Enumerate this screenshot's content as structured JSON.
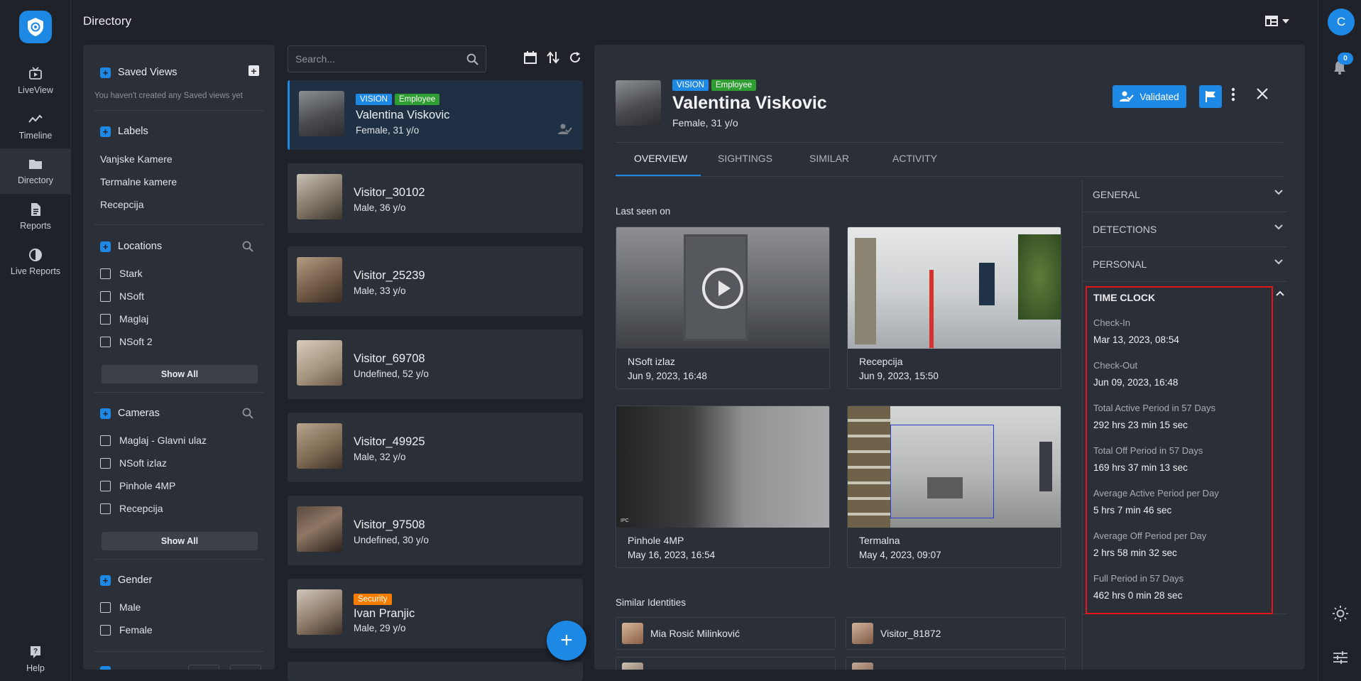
{
  "nav": {
    "items": [
      {
        "label": "LiveView",
        "icon": "liveview-icon"
      },
      {
        "label": "Timeline",
        "icon": "timeline-icon"
      },
      {
        "label": "Directory",
        "icon": "folder-icon"
      },
      {
        "label": "Reports",
        "icon": "reports-icon"
      },
      {
        "label": "Live Reports",
        "icon": "live-reports-icon"
      }
    ],
    "help": "Help"
  },
  "page": {
    "title": "Directory"
  },
  "user": {
    "initial": "C",
    "notifications": "0"
  },
  "filters": {
    "saved_views": {
      "title": "Saved Views",
      "note": "You haven't created any Saved views yet"
    },
    "labels": {
      "title": "Labels",
      "items": [
        "Vanjske Kamere",
        "Termalne kamere",
        "Recepcija"
      ]
    },
    "locations": {
      "title": "Locations",
      "items": [
        "Stark",
        "NSoft",
        "Maglaj",
        "NSoft 2"
      ],
      "show_all": "Show All"
    },
    "cameras": {
      "title": "Cameras",
      "items": [
        "Maglaj - Glavni ulaz",
        "NSoft izlaz",
        "Pinhole 4MP",
        "Recepcija"
      ],
      "show_all": "Show All"
    },
    "gender": {
      "title": "Gender",
      "items": [
        "Male",
        "Female"
      ]
    }
  },
  "search": {
    "placeholder": "Search..."
  },
  "results": [
    {
      "name": "Valentina Viskovic",
      "meta": "Female, 31 y/o",
      "tags": [
        "VISION",
        "Employee"
      ]
    },
    {
      "name": "Visitor_30102",
      "meta": "Male, 36 y/o",
      "tags": []
    },
    {
      "name": "Visitor_25239",
      "meta": "Male, 33 y/o",
      "tags": []
    },
    {
      "name": "Visitor_69708",
      "meta": "Undefined, 52 y/o",
      "tags": []
    },
    {
      "name": "Visitor_49925",
      "meta": "Male, 32 y/o",
      "tags": []
    },
    {
      "name": "Visitor_97508",
      "meta": "Undefined, 30 y/o",
      "tags": []
    },
    {
      "name": "Ivan Pranjic",
      "meta": "Male, 29 y/o",
      "tags": [
        "Security"
      ]
    }
  ],
  "detail": {
    "name": "Valentina Viskovic",
    "meta": "Female, 31 y/o",
    "tags": [
      "VISION",
      "Employee"
    ],
    "validated_label": "Validated",
    "tabs": [
      "OVERVIEW",
      "SIGHTINGS",
      "SIMILAR",
      "ACTIVITY"
    ],
    "last_seen_label": "Last seen on",
    "sightings": [
      {
        "location": "NSoft izlaz",
        "time": "Jun 9, 2023, 16:48"
      },
      {
        "location": "Recepcija",
        "time": "Jun 9, 2023, 15:50"
      },
      {
        "location": "Pinhole 4MP",
        "time": "May 16, 2023, 16:54"
      },
      {
        "location": "Termalna",
        "time": "May 4, 2023, 09:07"
      }
    ],
    "camera_overlay_text": "IPC",
    "similar_label": "Similar Identities",
    "similar": [
      "Mia Rosić Milinković",
      "Visitor_81872"
    ],
    "accordion": [
      "GENERAL",
      "DETECTIONS",
      "PERSONAL"
    ],
    "time_clock": {
      "title": "TIME CLOCK",
      "fields": [
        {
          "label": "Check-In",
          "value": "Mar 13, 2023, 08:54"
        },
        {
          "label": "Check-Out",
          "value": "Jun 09, 2023, 16:48"
        },
        {
          "label": "Total Active Period in 57 Days",
          "value": "292 hrs 23 min 15 sec"
        },
        {
          "label": "Total Off Period in 57 Days",
          "value": "169 hrs 37 min 13 sec"
        },
        {
          "label": "Average Active Period per Day",
          "value": "5 hrs 7 min 46 sec"
        },
        {
          "label": "Average Off Period per Day",
          "value": "2 hrs 58 min 32 sec"
        },
        {
          "label": "Full Period in 57 Days",
          "value": "462 hrs 0 min 28 sec"
        }
      ]
    }
  },
  "colors": {
    "accent": "#1e88e5",
    "employee": "#2e9d32",
    "security": "#f57c00",
    "highlight": "#e3161b"
  }
}
